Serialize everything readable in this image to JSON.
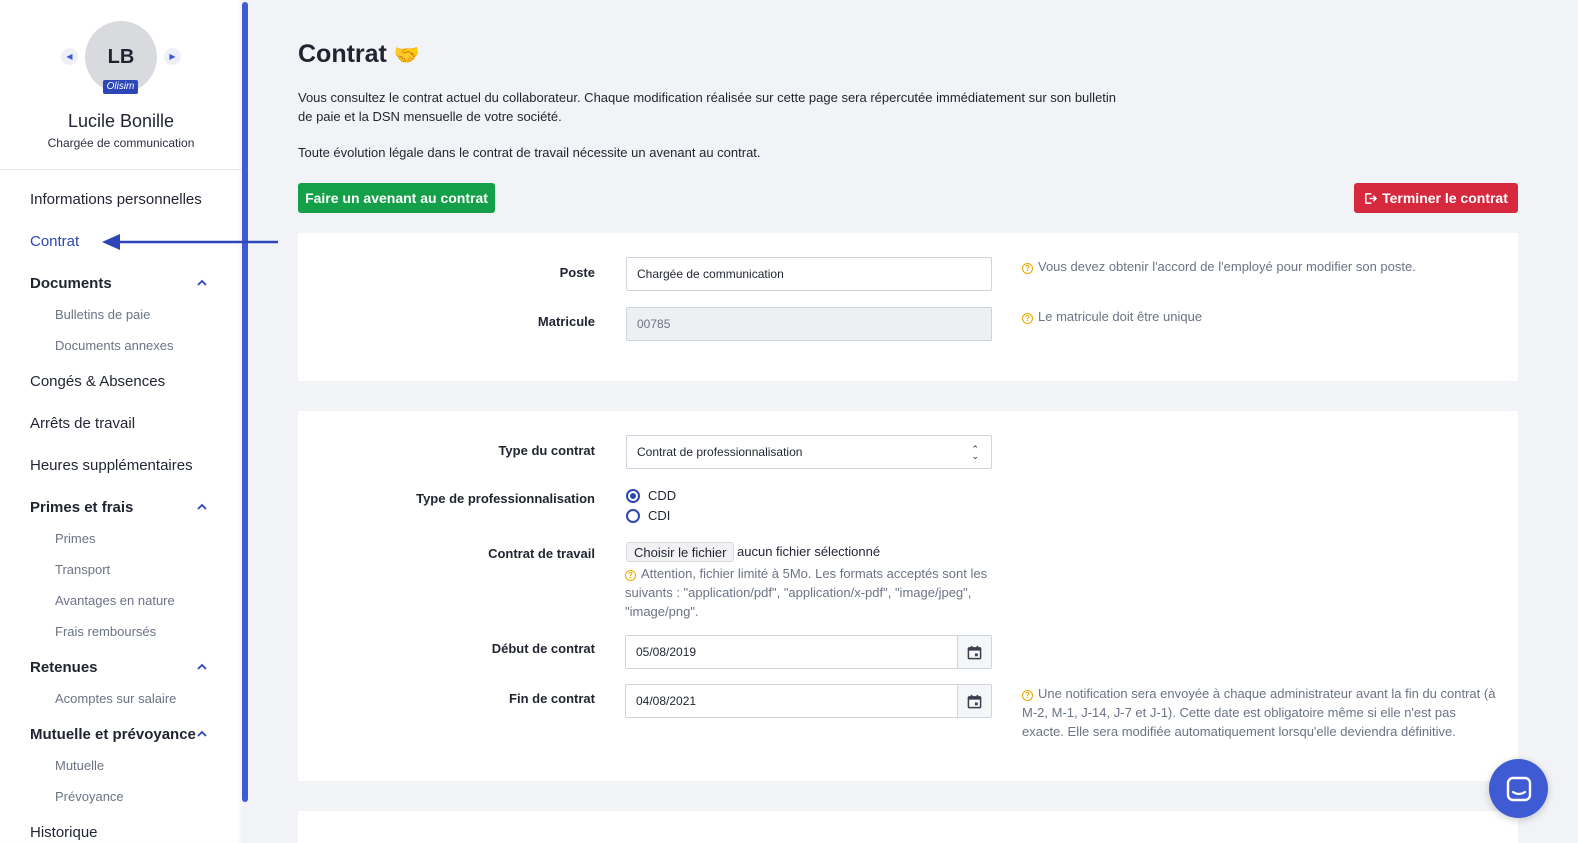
{
  "profile": {
    "initials": "LB",
    "badge": "Olisim",
    "name": "Lucile Bonille",
    "role": "Chargée de communication"
  },
  "sidebar": {
    "items": [
      {
        "label": "Informations personnelles"
      },
      {
        "label": "Contrat"
      },
      {
        "label": "Documents"
      },
      {
        "label": "Bulletins de paie"
      },
      {
        "label": "Documents annexes"
      },
      {
        "label": "Congés & Absences"
      },
      {
        "label": "Arrêts de travail"
      },
      {
        "label": "Heures supplémentaires"
      },
      {
        "label": "Primes et frais"
      },
      {
        "label": "Primes"
      },
      {
        "label": "Transport"
      },
      {
        "label": "Avantages en nature"
      },
      {
        "label": "Frais remboursés"
      },
      {
        "label": "Retenues"
      },
      {
        "label": "Acomptes sur salaire"
      },
      {
        "label": "Mutuelle et prévoyance"
      },
      {
        "label": "Mutuelle"
      },
      {
        "label": "Prévoyance"
      },
      {
        "label": "Historique"
      }
    ]
  },
  "page": {
    "title": "Contrat",
    "title_emoji": "🤝",
    "intro": "Vous consultez le contrat actuel du collaborateur. Chaque modification réalisée sur cette page sera répercutée immédiatement sur son bulletin de paie et la DSN mensuelle de votre société.",
    "intro2": "Toute évolution légale dans le contrat de travail nécessite un avenant au contrat.",
    "avenant_button": "Faire un avenant au contrat",
    "terminate_button": "Terminer le contrat"
  },
  "card1": {
    "poste_label": "Poste",
    "poste_value": "Chargée de communication",
    "poste_hint": "Vous devez obtenir l'accord de l'employé pour modifier son poste.",
    "matricule_label": "Matricule",
    "matricule_value": "00785",
    "matricule_hint": "Le matricule doit être unique"
  },
  "card2": {
    "type_label": "Type du contrat",
    "type_value": "Contrat de professionnalisation",
    "pro_label": "Type de professionnalisation",
    "pro_options": [
      "CDD",
      "CDI"
    ],
    "pro_selected": "CDD",
    "file_label": "Contrat de travail",
    "file_button": "Choisir le fichier",
    "file_status": "aucun fichier sélectionné",
    "file_hint": "Attention, fichier limité à 5Mo. Les formats acceptés sont les suivants : \"application/pdf\", \"application/x-pdf\", \"image/jpeg\", \"image/png\".",
    "start_label": "Début de contrat",
    "start_value": "05/08/2019",
    "end_label": "Fin de contrat",
    "end_value": "04/08/2021",
    "end_hint": "Une notification sera envoyée à chaque administrateur avant la fin du contrat (à M-2, M-1, J-14, J-7 et J-1). Cette date est obligatoire même si elle n'est pas exacte. Elle sera modifiée automatiquement lorsqu'elle deviendra définitive."
  },
  "colors": {
    "accent": "#2c46b8",
    "success": "#14a049",
    "danger": "#d6293e",
    "hint": "#e9a700"
  }
}
